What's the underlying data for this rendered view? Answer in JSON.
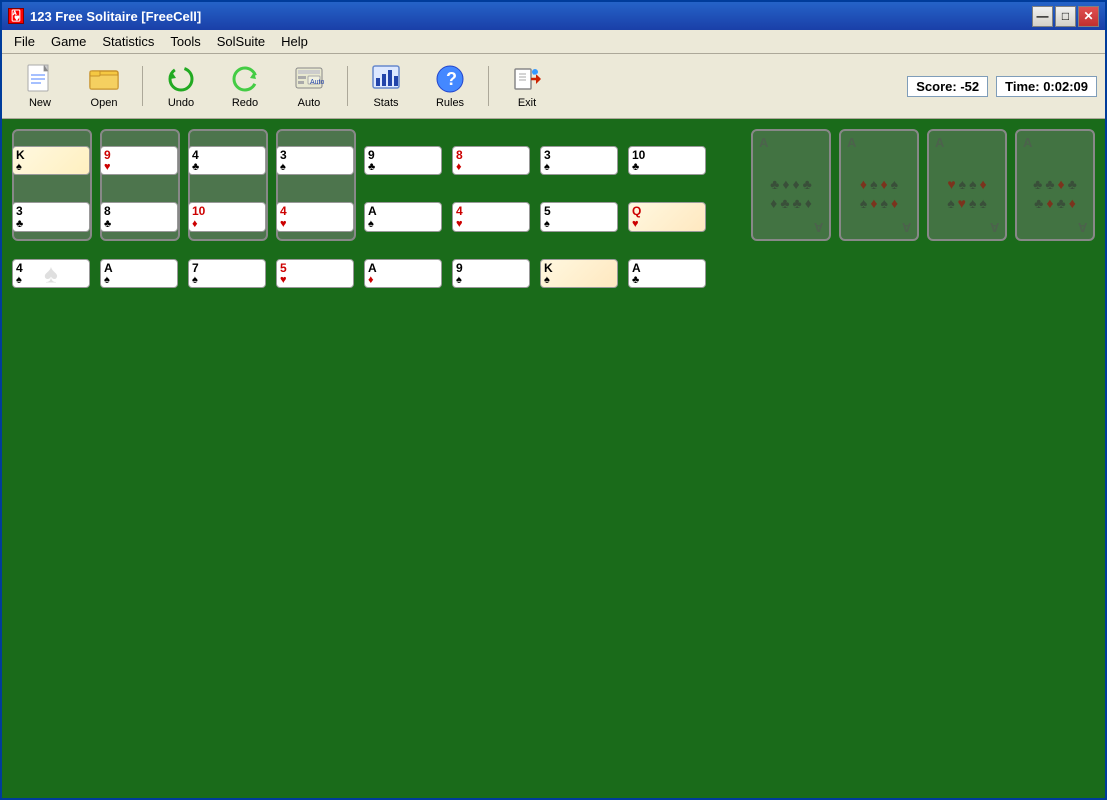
{
  "window": {
    "title": "123 Free Solitaire  [FreeCell]",
    "title_icon": "🃏"
  },
  "title_buttons": {
    "minimize": "—",
    "maximize": "□",
    "close": "✕"
  },
  "menu": {
    "items": [
      "File",
      "Game",
      "Statistics",
      "Tools",
      "SolSuite",
      "Help"
    ]
  },
  "toolbar": {
    "buttons": [
      {
        "id": "new",
        "label": "New"
      },
      {
        "id": "open",
        "label": "Open"
      },
      {
        "id": "undo",
        "label": "Undo"
      },
      {
        "id": "redo",
        "label": "Redo"
      },
      {
        "id": "auto",
        "label": "Auto"
      },
      {
        "id": "stats",
        "label": "Stats"
      },
      {
        "id": "rules",
        "label": "Rules"
      },
      {
        "id": "exit",
        "label": "Exit"
      }
    ],
    "score_label": "Score:",
    "score_value": "-52",
    "time_label": "Time:",
    "time_value": "0:02:09"
  },
  "colors": {
    "red": "#cc0000",
    "black": "#000000",
    "green_table": "#1a6b1a"
  }
}
